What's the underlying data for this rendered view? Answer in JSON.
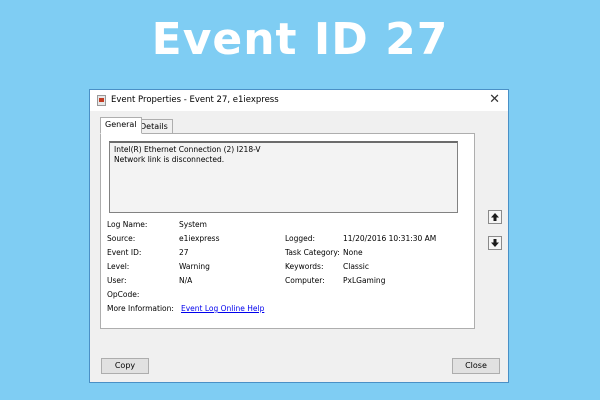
{
  "banner": {
    "title": "Event ID 27"
  },
  "window": {
    "title": "Event Properties - Event 27, e1iexpress",
    "close_glyph": "✕"
  },
  "tabs": [
    {
      "label": "General",
      "active": true
    },
    {
      "label": "Details",
      "active": false
    }
  ],
  "description": {
    "line1": "Intel(R) Ethernet Connection (2) I218-V",
    "line2": "Network link is disconnected."
  },
  "fields": {
    "log_name": {
      "label": "Log Name:",
      "value": "System"
    },
    "source": {
      "label": "Source:",
      "value": "e1iexpress"
    },
    "logged": {
      "label": "Logged:",
      "value": "11/20/2016 10:31:30 AM"
    },
    "event_id": {
      "label": "Event ID:",
      "value": "27"
    },
    "task_category": {
      "label": "Task Category:",
      "value": "None"
    },
    "level": {
      "label": "Level:",
      "value": "Warning"
    },
    "keywords": {
      "label": "Keywords:",
      "value": "Classic"
    },
    "user": {
      "label": "User:",
      "value": "N/A"
    },
    "computer": {
      "label": "Computer:",
      "value": "PxLGaming"
    },
    "opcode": {
      "label": "OpCode:",
      "value": ""
    },
    "more_info": {
      "label": "More Information:",
      "value": "Event Log Online Help"
    }
  },
  "buttons": {
    "copy": "Copy",
    "close": "Close"
  },
  "icons": {
    "up": "arrow-up-icon",
    "down": "arrow-down-icon"
  }
}
